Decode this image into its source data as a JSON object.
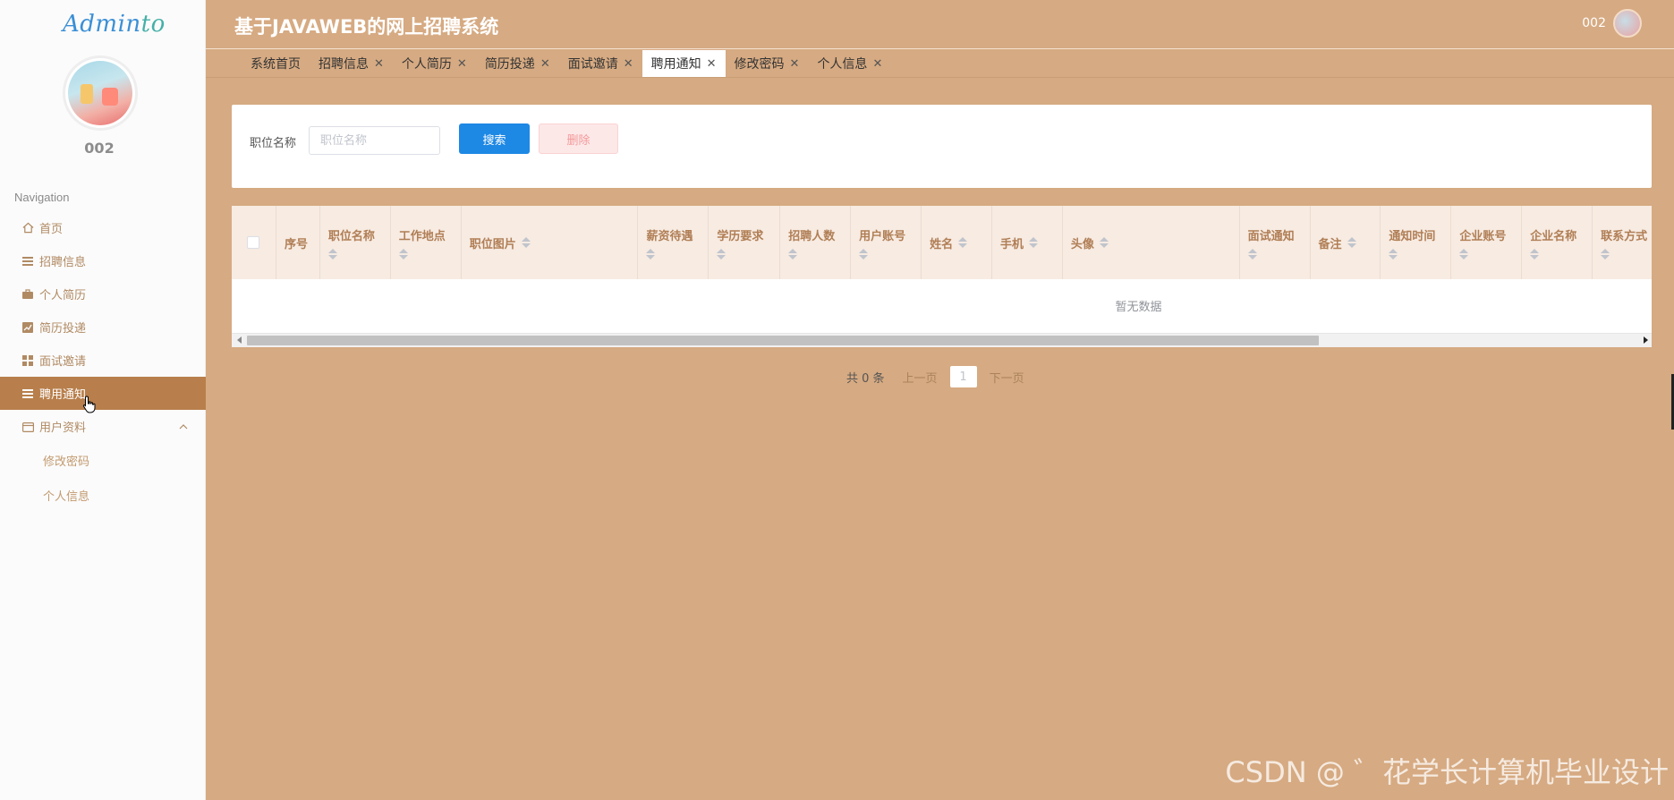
{
  "sidebar": {
    "logo_main": "Admin",
    "logo_alt": "to",
    "username": "002",
    "nav_title": "Navigation",
    "items": [
      {
        "label": "首页",
        "icon": "home-icon"
      },
      {
        "label": "招聘信息",
        "icon": "list-icon"
      },
      {
        "label": "个人简历",
        "icon": "briefcase-icon"
      },
      {
        "label": "简历投递",
        "icon": "chart-icon"
      },
      {
        "label": "面试邀请",
        "icon": "grid-icon"
      },
      {
        "label": "聘用通知",
        "icon": "list-icon",
        "active": true
      }
    ],
    "group": {
      "label": "用户资料",
      "icon": "folder-icon",
      "expanded": true
    },
    "subitems": [
      "修改密码",
      "个人信息"
    ]
  },
  "header": {
    "title": "基于JAVAWEB的网上招聘系统",
    "user": "002"
  },
  "tabs": [
    {
      "label": "系统首页",
      "closable": false
    },
    {
      "label": "招聘信息",
      "closable": true
    },
    {
      "label": "个人简历",
      "closable": true
    },
    {
      "label": "简历投递",
      "closable": true
    },
    {
      "label": "面试邀请",
      "closable": true
    },
    {
      "label": "聘用通知",
      "closable": true,
      "active": true
    },
    {
      "label": "修改密码",
      "closable": true
    },
    {
      "label": "个人信息",
      "closable": true
    }
  ],
  "tab_close_symbol": "✕",
  "search": {
    "label": "职位名称",
    "placeholder": "职位名称",
    "value": "",
    "search_button": "搜索",
    "delete_button": "删除"
  },
  "table": {
    "columns": [
      {
        "label": "序号",
        "sortable": false
      },
      {
        "label": "职位名称",
        "sortable": true
      },
      {
        "label": "工作地点",
        "sortable": true
      },
      {
        "label": "职位图片",
        "sortable": true
      },
      {
        "label": "薪资待遇",
        "sortable": true
      },
      {
        "label": "学历要求",
        "sortable": true
      },
      {
        "label": "招聘人数",
        "sortable": true
      },
      {
        "label": "用户账号",
        "sortable": true
      },
      {
        "label": "姓名",
        "sortable": true
      },
      {
        "label": "手机",
        "sortable": true
      },
      {
        "label": "头像",
        "sortable": true
      },
      {
        "label": "面试通知",
        "sortable": true
      },
      {
        "label": "备注",
        "sortable": true
      },
      {
        "label": "通知时间",
        "sortable": true
      },
      {
        "label": "企业账号",
        "sortable": true
      },
      {
        "label": "企业名称",
        "sortable": true
      },
      {
        "label": "联系方式",
        "sortable": true
      }
    ],
    "empty_text": "暂无数据"
  },
  "pagination": {
    "total": "共 0 条",
    "prev": "上一页",
    "current": "1",
    "next": "下一页"
  },
  "watermark": "CSDN @ ゛花学长计算机毕业设计",
  "colors": {
    "background": "#d6aa82",
    "active_menu": "#b87f4c",
    "primary_button": "#1e88e5",
    "danger_button": "#fde8e8"
  }
}
